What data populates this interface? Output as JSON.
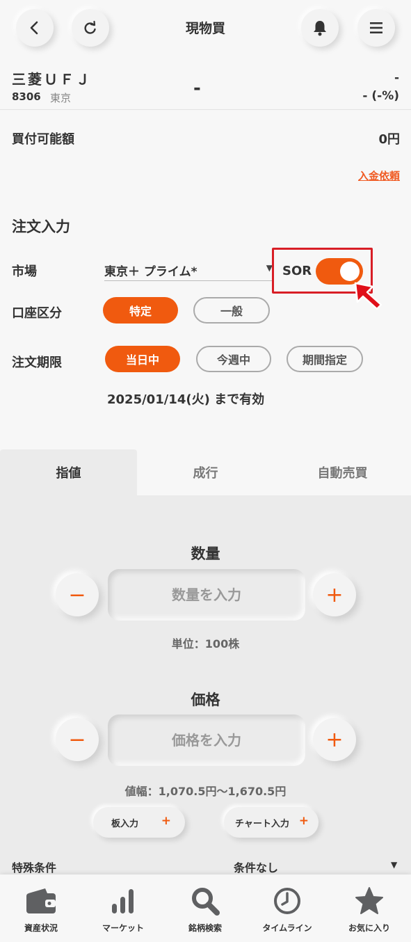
{
  "header": {
    "title": "現物買",
    "back_icon": "chevron-left-icon",
    "refresh_icon": "refresh-icon",
    "bell_icon": "bell-icon",
    "menu_icon": "menu-icon"
  },
  "stock": {
    "name": "三菱ＵＦＪ",
    "code": "8306",
    "market": "東京",
    "price": "-",
    "change": "-",
    "change_pct": "- (-%)"
  },
  "buying_power": {
    "label": "買付可能額",
    "value": "0円",
    "deposit_link": "入金依頼"
  },
  "order_input": {
    "section_title": "注文入力",
    "market": {
      "label": "市場",
      "value": "東京＋ プライム*",
      "sor_label": "SOR",
      "sor_enabled": true
    },
    "account": {
      "label": "口座区分",
      "options": [
        "特定",
        "一般"
      ],
      "selected": "特定"
    },
    "term": {
      "label": "注文期限",
      "options": [
        "当日中",
        "今週中",
        "期間指定"
      ],
      "selected": "当日中",
      "valid_until": "2025/01/14(火) まで有効"
    }
  },
  "tabs": [
    {
      "label": "指値",
      "active": true
    },
    {
      "label": "成行",
      "active": false
    },
    {
      "label": "自動売買",
      "active": false
    }
  ],
  "quantity": {
    "title": "数量",
    "placeholder": "数量を入力",
    "unit_hint": "単位：100株",
    "minus": "−",
    "plus": "+"
  },
  "price": {
    "title": "価格",
    "placeholder": "価格を入力",
    "range_hint": "値幅：1,070.5円～1,670.5円",
    "minus": "−",
    "plus": "+",
    "board_button": "板入力",
    "chart_button": "チャート入力",
    "button_plus": "+"
  },
  "special_condition": {
    "label": "特殊条件",
    "value": "条件なし"
  },
  "bottom_nav": [
    {
      "label": "資産状況",
      "icon": "wallet-icon"
    },
    {
      "label": "マーケット",
      "icon": "bar-chart-icon"
    },
    {
      "label": "銘柄検索",
      "icon": "search-icon"
    },
    {
      "label": "タイムライン",
      "icon": "clock-icon"
    },
    {
      "label": "お気に入り",
      "icon": "star-icon"
    }
  ],
  "colors": {
    "accent": "#f05a0f",
    "highlight_border": "#d81e26",
    "text": "#333333",
    "icon_gray": "#5f6062"
  }
}
